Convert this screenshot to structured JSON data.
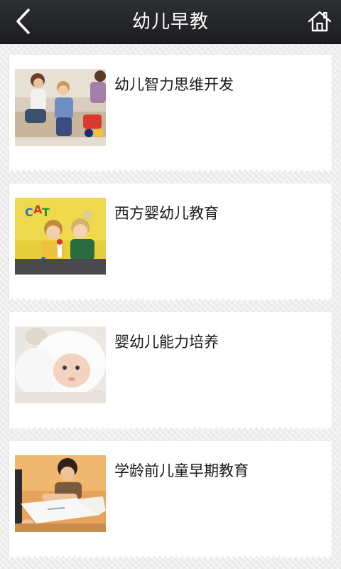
{
  "header": {
    "title": "幼儿早教",
    "back_icon": "chevron-left-icon",
    "home_icon": "home-icon"
  },
  "items": [
    {
      "title": "幼儿智力思维开发",
      "image": "family-with-toddler-photo"
    },
    {
      "title": "西方婴幼儿教育",
      "image": "children-playing-with-toys-photo"
    },
    {
      "title": "婴幼儿能力培养",
      "image": "baby-in-white-towel-photo"
    },
    {
      "title": "学龄前儿童早期教育",
      "image": "child-drawing-at-table-photo"
    }
  ],
  "colors": {
    "header_bg": "#232427",
    "card_bg": "#ffffff",
    "page_bg": "#eeeeee",
    "title_text": "#ffffff",
    "item_text": "#1a1a1a"
  }
}
